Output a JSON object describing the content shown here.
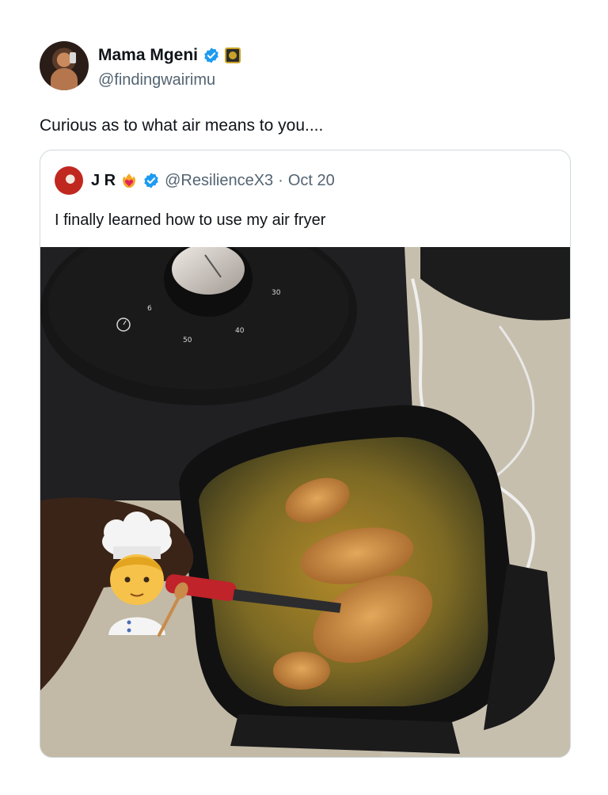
{
  "tweet": {
    "author": {
      "display_name": "Mama Mgeni",
      "handle": "@findingwairimu",
      "verified": true,
      "avatar_icon": "profile-photo-icon",
      "affiliation_icon": "affiliate-badge-icon"
    },
    "text": "Curious as to what air means to you....",
    "quoted": {
      "author": {
        "display_name": "J R",
        "name_emoji_icon": "heart-on-fire-icon",
        "handle": "@ResilienceX3",
        "separator": "·",
        "date": "Oct 20",
        "verified": true
      },
      "text": "I finally learned how to use my air fryer",
      "media": {
        "description_icon": "air-fryer-photo",
        "overlay_emoji_icon": "cook-emoji-icon",
        "dial_labels": [
          "30",
          "40",
          "50",
          "6"
        ]
      }
    }
  },
  "colors": {
    "verified_blue": "#1d9bf0",
    "secondary_text": "#536471",
    "border": "#cfd9de"
  }
}
